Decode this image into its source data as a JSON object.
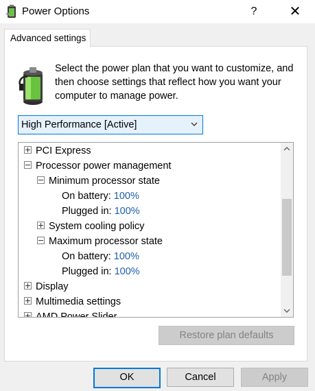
{
  "window": {
    "title": "Power Options",
    "help_glyph": "?",
    "close_glyph": "✕"
  },
  "tab": {
    "label": "Advanced settings"
  },
  "description": "Select the power plan that you want to customize, and then choose settings that reflect how you want your computer to manage power.",
  "plan_select": {
    "value": "High Performance [Active]"
  },
  "tree": {
    "pci_express": "PCI Express",
    "processor_power_management": "Processor power management",
    "minimum_processor_state": "Minimum processor state",
    "min_on_battery_label": "On battery:",
    "min_on_battery_value": "100%",
    "min_plugged_in_label": "Plugged in:",
    "min_plugged_in_value": "100%",
    "system_cooling_policy": "System cooling policy",
    "maximum_processor_state": "Maximum processor state",
    "max_on_battery_label": "On battery:",
    "max_on_battery_value": "100%",
    "max_plugged_in_label": "Plugged in:",
    "max_plugged_in_value": "100%",
    "display": "Display",
    "multimedia_settings": "Multimedia settings",
    "amd_power_slider": "AMD Power Slider"
  },
  "buttons": {
    "restore": "Restore plan defaults",
    "ok": "OK",
    "cancel": "Cancel",
    "apply": "Apply"
  },
  "colors": {
    "accent": "#0078d7",
    "value_link": "#1e5ea8",
    "disabled_text": "#838383"
  },
  "icons": {
    "app": "power-options-icon",
    "plan": "battery-plug-icon"
  }
}
